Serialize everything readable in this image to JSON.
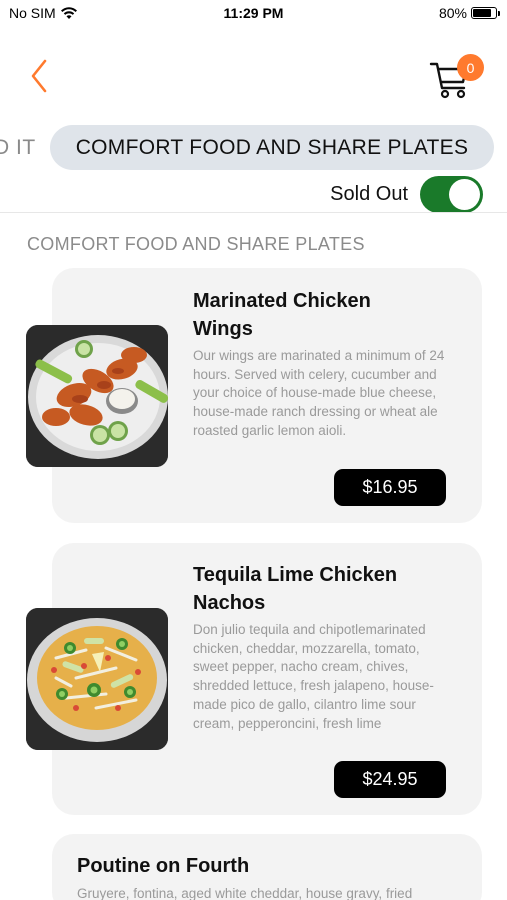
{
  "status_bar": {
    "carrier": "No SIM",
    "time": "11:29 PM",
    "battery": "80%",
    "battery_level": 0.8
  },
  "header": {
    "back_icon": "chevron-left-icon",
    "cart_icon": "cart-icon",
    "cart_count": "0",
    "accent_color": "#ff7a2e"
  },
  "tabs": {
    "previous_partial": "D IT",
    "active": "COMFORT FOOD AND SHARE PLATES"
  },
  "filter": {
    "sold_out_label": "Sold Out",
    "sold_out_enabled": true,
    "toggle_color": "#1a7a2a"
  },
  "section": {
    "title": "COMFORT FOOD AND SHARE PLATES"
  },
  "items": [
    {
      "name": "Marinated Chicken Wings",
      "description": "Our wings are marinated a minimum of 24 hours. Served with celery, cucumber and your choice of house-made blue cheese, house-made ranch dressing or wheat ale roasted garlic lemon aioli.",
      "price": "$16.95"
    },
    {
      "name": "Tequila Lime Chicken Nachos",
      "description": "Don julio tequila and chipotlemarinated chicken, cheddar, mozzarella, tomato, sweet pepper, nacho cream, chives, shredded lettuce, fresh jalapeno, house-made pico de gallo, cilantro lime sour cream, pepperoncini, fresh lime",
      "price": "$24.95"
    },
    {
      "name": "Poutine on Fourth",
      "description": "Gruyere, fontina, aged white cheddar, house gravy, fried"
    }
  ]
}
